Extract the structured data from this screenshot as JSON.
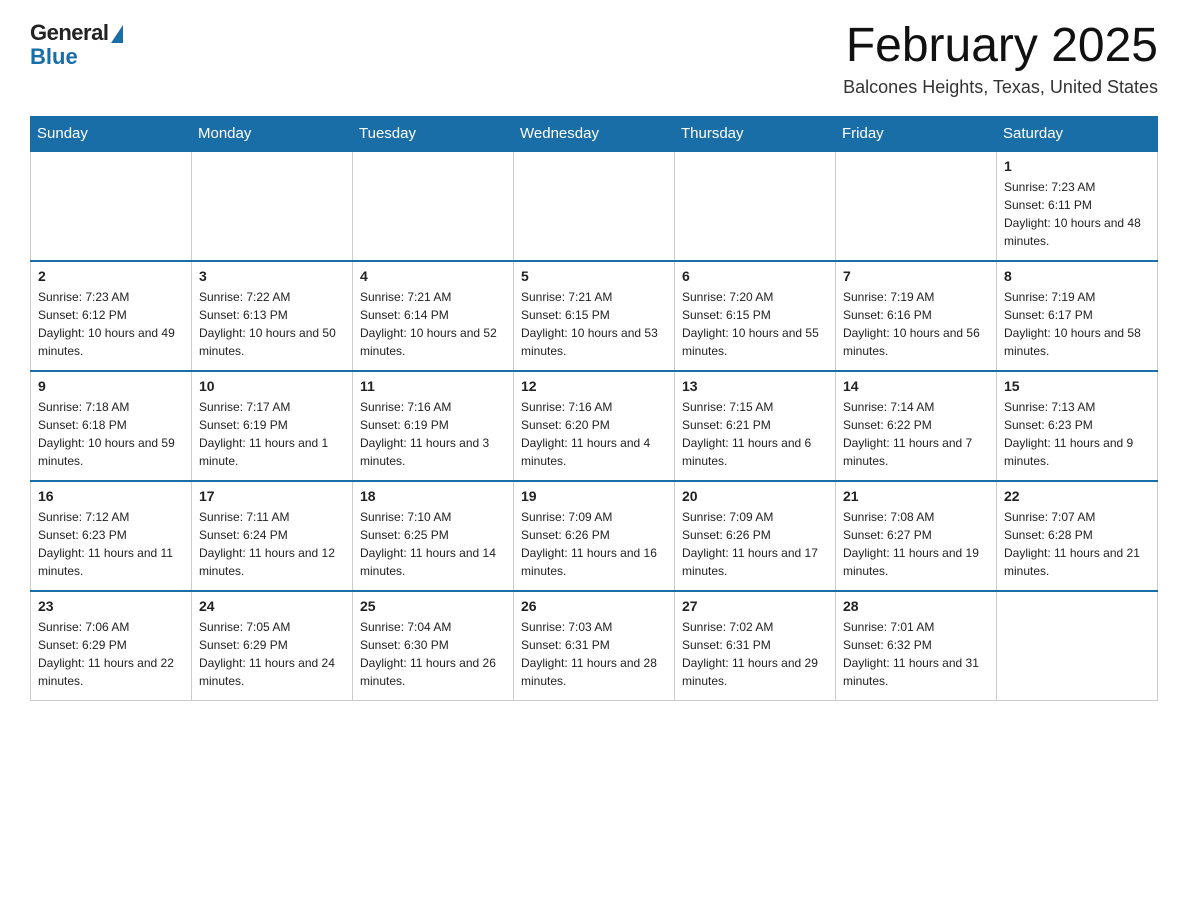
{
  "logo": {
    "general": "General",
    "blue": "Blue"
  },
  "title": "February 2025",
  "location": "Balcones Heights, Texas, United States",
  "headers": [
    "Sunday",
    "Monday",
    "Tuesday",
    "Wednesday",
    "Thursday",
    "Friday",
    "Saturday"
  ],
  "weeks": [
    [
      {
        "day": "",
        "info": ""
      },
      {
        "day": "",
        "info": ""
      },
      {
        "day": "",
        "info": ""
      },
      {
        "day": "",
        "info": ""
      },
      {
        "day": "",
        "info": ""
      },
      {
        "day": "",
        "info": ""
      },
      {
        "day": "1",
        "info": "Sunrise: 7:23 AM\nSunset: 6:11 PM\nDaylight: 10 hours and 48 minutes."
      }
    ],
    [
      {
        "day": "2",
        "info": "Sunrise: 7:23 AM\nSunset: 6:12 PM\nDaylight: 10 hours and 49 minutes."
      },
      {
        "day": "3",
        "info": "Sunrise: 7:22 AM\nSunset: 6:13 PM\nDaylight: 10 hours and 50 minutes."
      },
      {
        "day": "4",
        "info": "Sunrise: 7:21 AM\nSunset: 6:14 PM\nDaylight: 10 hours and 52 minutes."
      },
      {
        "day": "5",
        "info": "Sunrise: 7:21 AM\nSunset: 6:15 PM\nDaylight: 10 hours and 53 minutes."
      },
      {
        "day": "6",
        "info": "Sunrise: 7:20 AM\nSunset: 6:15 PM\nDaylight: 10 hours and 55 minutes."
      },
      {
        "day": "7",
        "info": "Sunrise: 7:19 AM\nSunset: 6:16 PM\nDaylight: 10 hours and 56 minutes."
      },
      {
        "day": "8",
        "info": "Sunrise: 7:19 AM\nSunset: 6:17 PM\nDaylight: 10 hours and 58 minutes."
      }
    ],
    [
      {
        "day": "9",
        "info": "Sunrise: 7:18 AM\nSunset: 6:18 PM\nDaylight: 10 hours and 59 minutes."
      },
      {
        "day": "10",
        "info": "Sunrise: 7:17 AM\nSunset: 6:19 PM\nDaylight: 11 hours and 1 minute."
      },
      {
        "day": "11",
        "info": "Sunrise: 7:16 AM\nSunset: 6:19 PM\nDaylight: 11 hours and 3 minutes."
      },
      {
        "day": "12",
        "info": "Sunrise: 7:16 AM\nSunset: 6:20 PM\nDaylight: 11 hours and 4 minutes."
      },
      {
        "day": "13",
        "info": "Sunrise: 7:15 AM\nSunset: 6:21 PM\nDaylight: 11 hours and 6 minutes."
      },
      {
        "day": "14",
        "info": "Sunrise: 7:14 AM\nSunset: 6:22 PM\nDaylight: 11 hours and 7 minutes."
      },
      {
        "day": "15",
        "info": "Sunrise: 7:13 AM\nSunset: 6:23 PM\nDaylight: 11 hours and 9 minutes."
      }
    ],
    [
      {
        "day": "16",
        "info": "Sunrise: 7:12 AM\nSunset: 6:23 PM\nDaylight: 11 hours and 11 minutes."
      },
      {
        "day": "17",
        "info": "Sunrise: 7:11 AM\nSunset: 6:24 PM\nDaylight: 11 hours and 12 minutes."
      },
      {
        "day": "18",
        "info": "Sunrise: 7:10 AM\nSunset: 6:25 PM\nDaylight: 11 hours and 14 minutes."
      },
      {
        "day": "19",
        "info": "Sunrise: 7:09 AM\nSunset: 6:26 PM\nDaylight: 11 hours and 16 minutes."
      },
      {
        "day": "20",
        "info": "Sunrise: 7:09 AM\nSunset: 6:26 PM\nDaylight: 11 hours and 17 minutes."
      },
      {
        "day": "21",
        "info": "Sunrise: 7:08 AM\nSunset: 6:27 PM\nDaylight: 11 hours and 19 minutes."
      },
      {
        "day": "22",
        "info": "Sunrise: 7:07 AM\nSunset: 6:28 PM\nDaylight: 11 hours and 21 minutes."
      }
    ],
    [
      {
        "day": "23",
        "info": "Sunrise: 7:06 AM\nSunset: 6:29 PM\nDaylight: 11 hours and 22 minutes."
      },
      {
        "day": "24",
        "info": "Sunrise: 7:05 AM\nSunset: 6:29 PM\nDaylight: 11 hours and 24 minutes."
      },
      {
        "day": "25",
        "info": "Sunrise: 7:04 AM\nSunset: 6:30 PM\nDaylight: 11 hours and 26 minutes."
      },
      {
        "day": "26",
        "info": "Sunrise: 7:03 AM\nSunset: 6:31 PM\nDaylight: 11 hours and 28 minutes."
      },
      {
        "day": "27",
        "info": "Sunrise: 7:02 AM\nSunset: 6:31 PM\nDaylight: 11 hours and 29 minutes."
      },
      {
        "day": "28",
        "info": "Sunrise: 7:01 AM\nSunset: 6:32 PM\nDaylight: 11 hours and 31 minutes."
      },
      {
        "day": "",
        "info": ""
      }
    ]
  ]
}
